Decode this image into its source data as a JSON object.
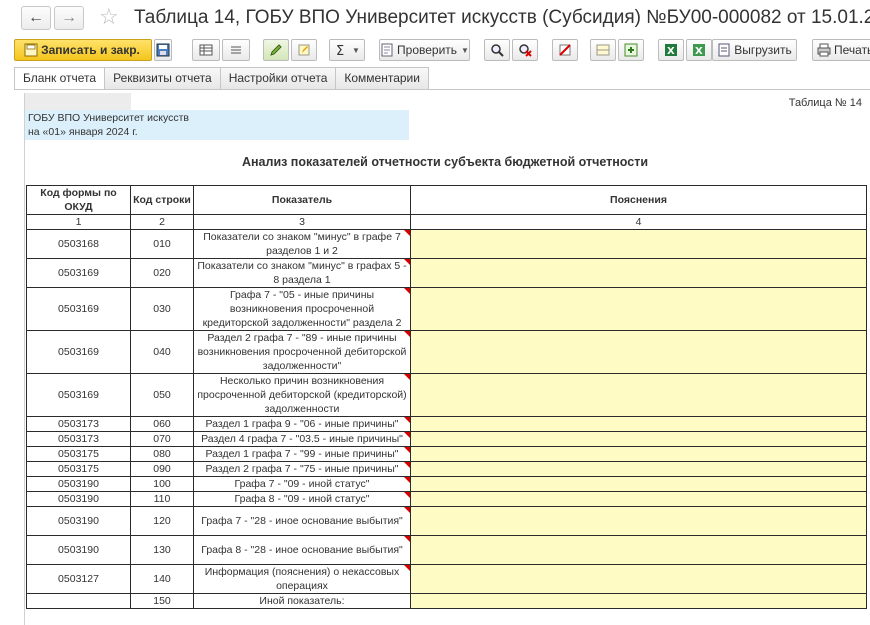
{
  "window": {
    "title": "Таблица 14, ГОБУ ВПО Университет искусств (Субсидия) №БУ00-000082 от 15.01.2"
  },
  "toolbar": {
    "save_close_label": "Записать и закр.",
    "check_label": "Проверить",
    "export_label": "Выгрузить",
    "print_label": "Печать"
  },
  "tabs": [
    {
      "label": "Бланк отчета",
      "active": true
    },
    {
      "label": "Реквизиты отчета",
      "active": false
    },
    {
      "label": "Настройки отчета",
      "active": false
    },
    {
      "label": "Комментарии",
      "active": false
    }
  ],
  "report": {
    "table_number": "Таблица № 14",
    "org_name": "ГОБУ ВПО Университет искусств",
    "date_line": "на «01» января 2024 г.",
    "title": "Анализ показателей отчетности субъекта бюджетной отчетности",
    "headers": {
      "col1": "Код формы по ОКУД",
      "col2": "Код строки",
      "col3": "Показатель",
      "col4": "Пояснения"
    },
    "col_numbers": [
      "1",
      "2",
      "3",
      "4"
    ],
    "rows": [
      {
        "okud": "0503168",
        "line": "010",
        "indicator": "Показатели со знаком \"минус\" в графе 7 разделов 1 и 2"
      },
      {
        "okud": "0503169",
        "line": "020",
        "indicator": "Показатели со знаком \"минус\" в графах 5 - 8 раздела 1"
      },
      {
        "okud": "0503169",
        "line": "030",
        "indicator": "Графа 7 - \"05 - иные причины возникновения просроченной кредиторской задолженности\" раздела 2"
      },
      {
        "okud": "0503169",
        "line": "040",
        "indicator": "Раздел 2 графа 7 - \"89 - иные причины возникновения просроченной дебиторской задолженности\""
      },
      {
        "okud": "0503169",
        "line": "050",
        "indicator": "Несколько причин возникновения просроченной дебиторской (кредиторской) задолженности"
      },
      {
        "okud": "0503173",
        "line": "060",
        "indicator": "Раздел 1 графа 9 - \"06 - иные причины\""
      },
      {
        "okud": "0503173",
        "line": "070",
        "indicator": "Раздел 4 графа 7 - \"03.5 - иные причины\""
      },
      {
        "okud": "0503175",
        "line": "080",
        "indicator": "Раздел 1 графа 7 - \"99 - иные причины\""
      },
      {
        "okud": "0503175",
        "line": "090",
        "indicator": "Раздел 2 графа 7 - \"75 - иные причины\""
      },
      {
        "okud": "0503190",
        "line": "100",
        "indicator": "Графа 7 - \"09 - иной статус\""
      },
      {
        "okud": "0503190",
        "line": "110",
        "indicator": "Графа 8 - \"09 - иной статус\""
      },
      {
        "okud": "0503190",
        "line": "120",
        "indicator": "Графа 7 - \"28 - иное основание выбытия\""
      },
      {
        "okud": "0503190",
        "line": "130",
        "indicator": "Графа 8 - \"28 - иное основание выбытия\""
      },
      {
        "okud": "0503127",
        "line": "140",
        "indicator": "Информация (пояснения) о некассовых операциях"
      },
      {
        "okud": "",
        "line": "150",
        "indicator": "Иной показатель:"
      }
    ]
  },
  "icons": [
    "back-arrow-icon",
    "forward-arrow-icon",
    "favorite-star-icon",
    "save-icon",
    "table-icon",
    "list-icon",
    "edit-pencil-icon",
    "edit-cell-icon",
    "sum-icon",
    "search-icon",
    "clear-search-icon",
    "delete-icon",
    "row-icon",
    "add-row-icon",
    "excel-icon",
    "excel-export-icon",
    "print-icon"
  ],
  "colors": {
    "primary_button": "#f4c51c",
    "explanation_cell": "#fefbc5",
    "org_box": "#dcf0fb",
    "flag": "#d40000"
  }
}
